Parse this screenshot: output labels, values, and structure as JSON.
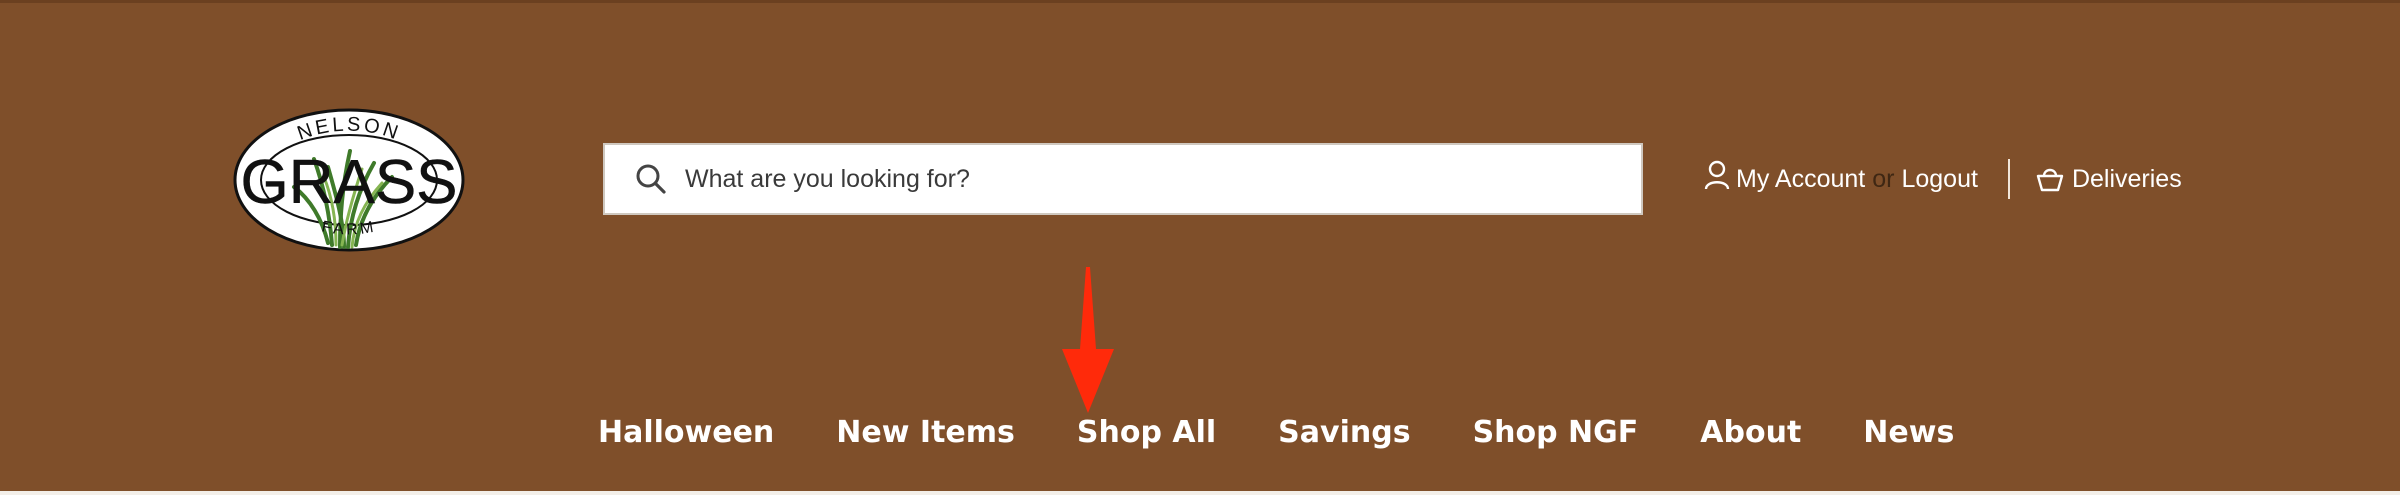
{
  "logo": {
    "top_text": "NELSON",
    "main_text": "GRASS",
    "bottom_text": "FARM"
  },
  "search": {
    "placeholder": "What are you looking for?",
    "icon": "search-icon"
  },
  "account": {
    "my_account": "My Account",
    "or": "or",
    "logout": "Logout",
    "deliveries": "Deliveries",
    "account_icon": "user-icon",
    "deliveries_icon": "basket-icon"
  },
  "nav": {
    "items": [
      "Halloween",
      "New Items",
      "Shop All",
      "Savings",
      "Shop NGF",
      "About",
      "News"
    ]
  },
  "colors": {
    "header_background": "#7f4f2a",
    "annotation_arrow": "#ff2a0a"
  }
}
